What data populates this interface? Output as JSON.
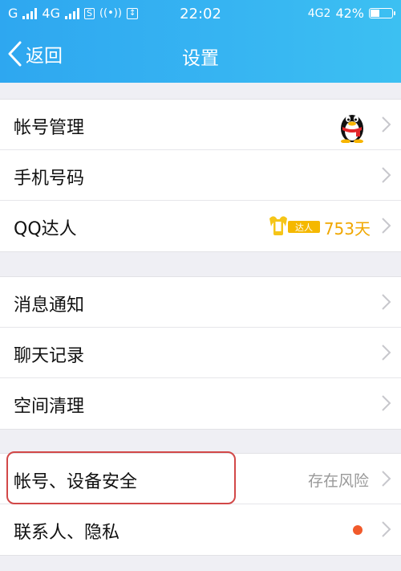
{
  "status_bar": {
    "carrier1": "G",
    "carrier2": "4G",
    "sim_badge": "S",
    "time": "22:02",
    "network_right": "4G2",
    "battery": "42%",
    "battery_level": 0.42
  },
  "nav": {
    "back_label": "返回",
    "title": "设置"
  },
  "groups": [
    {
      "items": [
        {
          "label": "帐号管理"
        },
        {
          "label": "手机号码"
        },
        {
          "label": "QQ达人",
          "badge_text": "达人",
          "value": "753天"
        }
      ]
    },
    {
      "items": [
        {
          "label": "消息通知"
        },
        {
          "label": "聊天记录"
        },
        {
          "label": "空间清理"
        }
      ]
    },
    {
      "items": [
        {
          "label": "帐号、设备安全",
          "value": "存在风险"
        },
        {
          "label": "联系人、隐私"
        }
      ]
    }
  ],
  "colors": {
    "header_start": "#2ea7f0",
    "header_end": "#3cc0f2",
    "highlight": "#d24848",
    "notify_dot": "#f15a2b",
    "days_text": "#f0a700"
  }
}
